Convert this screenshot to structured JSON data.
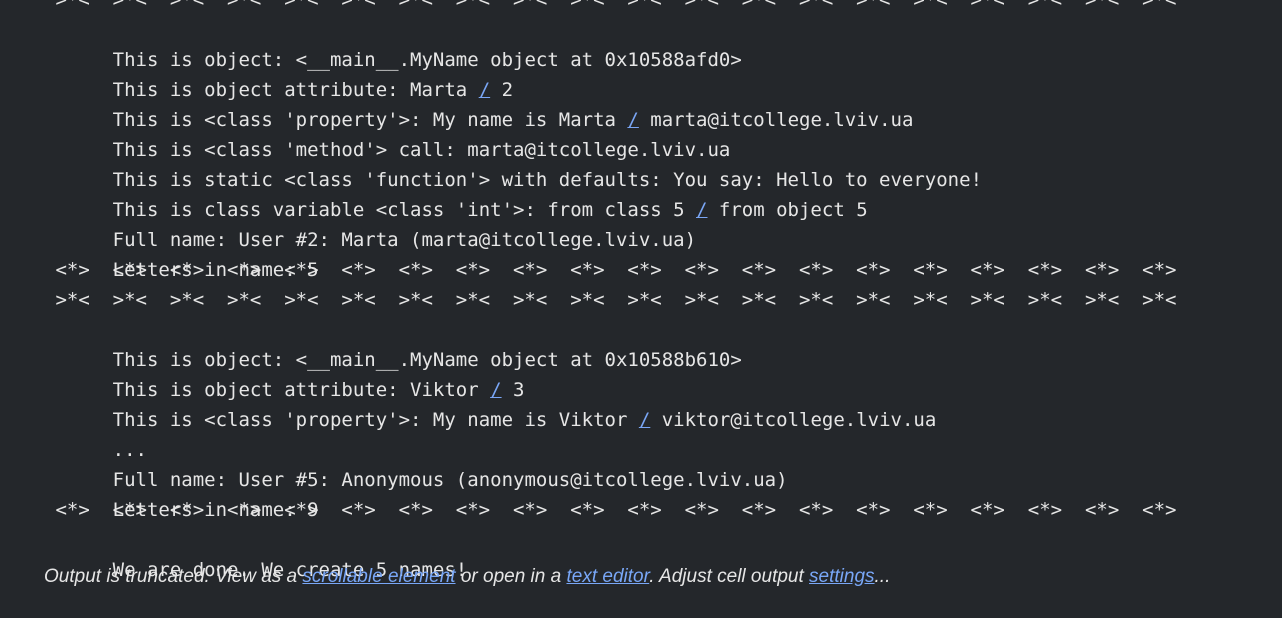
{
  "separators": {
    "pattern_a": " >*<  >*<  >*<  >*<  >*<  >*<  >*<  >*<  >*<  >*<  >*<  >*<  >*<  >*<  >*<  >*<  >*<  >*<  >*<  >*<",
    "pattern_b": " <*>  <*>  <*>  <*>  <*>  <*>  <*>  <*>  <*>  <*>  <*>  <*>  <*>  <*>  <*>  <*>  <*>  <*>  <*>  <*>"
  },
  "lines": {
    "l01_a": "This is object: <__main__.MyName object at 0x10588afd0>",
    "l02_a": "This is object attribute: Marta ",
    "l02_s": "/",
    "l02_b": " 2",
    "l03_a": "This is <class 'property'>: My name is Marta ",
    "l03_s": "/",
    "l03_b": " marta@itcollege.lviv.ua",
    "l04_a": "This is <class 'method'> call: marta@itcollege.lviv.ua",
    "l05_a": "This is static <class 'function'> with defaults: You say: Hello to everyone!",
    "l06_a": "This is class variable <class 'int'>: from class 5 ",
    "l06_s": "/",
    "l06_b": " from object 5",
    "l07_a": "Full name: User #2: Marta (marta@itcollege.lviv.ua)",
    "l08_a": "Letters in name: 5",
    "l11_a": "This is object: <__main__.MyName object at 0x10588b610>",
    "l12_a": "This is object attribute: Viktor ",
    "l12_s": "/",
    "l12_b": " 3",
    "l13_a": "This is <class 'property'>: My name is Viktor ",
    "l13_s": "/",
    "l13_b": " viktor@itcollege.lviv.ua",
    "l14_a": "...",
    "l15_a": "Full name: User #5: Anonymous (anonymous@itcollege.lviv.ua)",
    "l16_a": "Letters in name: 9",
    "l18_a": "We are done. We create 5 names!"
  },
  "truncated": {
    "t1": "Output is truncated. View as a ",
    "link_scrollable": "scrollable element",
    "t2": " or open in a ",
    "link_editor": "text editor",
    "t3": ". Adjust cell output ",
    "link_settings": "settings",
    "t4": "..."
  }
}
